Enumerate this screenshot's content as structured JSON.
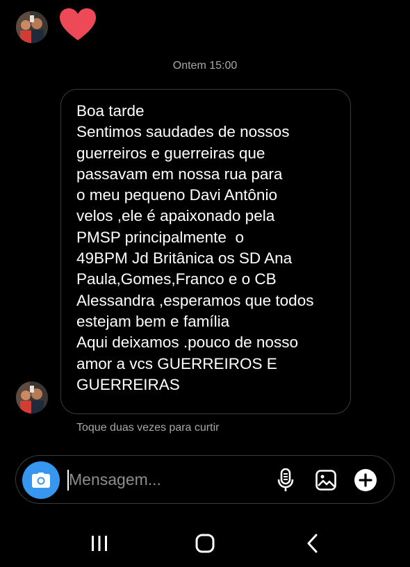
{
  "thread": {
    "timestamp": "Ontem 15:00",
    "hint": "Toque duas vezes para curtir"
  },
  "message": {
    "lines": [
      "Boa tarde",
      "Sentimos saudades de nossos",
      "guerreiros e guerreiras que",
      "passavam em nossa rua para",
      "o meu pequeno Davi Antônio",
      "velos ,ele é apaixonado pela",
      "PMSP principalmente  o",
      "49BPM Jd Britânica os SD Ana",
      "Paula,Gomes,Franco e o CB",
      "Alessandra ,esperamos que todos",
      "estejam bem e família",
      "Aqui deixamos .pouco de nosso",
      "amor a vcs GUERREIROS E",
      "GUERREIRAS"
    ]
  },
  "composer": {
    "placeholder": "Mensagem..."
  },
  "colors": {
    "background": "#000000",
    "accent_blue": "#3797f0",
    "heart_red": "#ed4956",
    "muted_text": "#a8a8a8",
    "border": "#3a3a3a"
  },
  "icons": {
    "reaction": "heart-icon",
    "camera": "camera-icon",
    "mic": "microphone-icon",
    "gallery": "gallery-icon",
    "plus": "plus-icon",
    "recents": "recents-icon",
    "home": "home-icon",
    "back": "back-icon"
  }
}
